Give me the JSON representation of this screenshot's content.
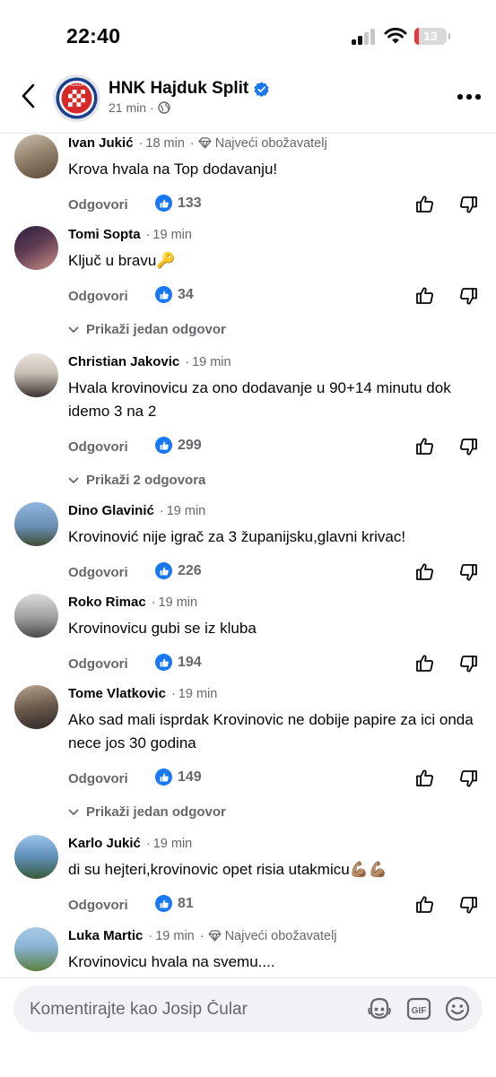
{
  "status_bar": {
    "time": "22:40",
    "battery": "13",
    "battery_color": "#e5383b"
  },
  "header": {
    "page_name": "HNK Hajduk Split",
    "time": "21 min",
    "separator": "·",
    "icons": {
      "back": "chevron-left-icon",
      "verified": "verified-badge-icon",
      "audience": "globe-icon",
      "more": "more-horizontal-icon"
    }
  },
  "actions_labels": {
    "reply": "Odgovori"
  },
  "accent_color": "#1877f2",
  "comments": [
    {
      "author": "Ivan Jukić",
      "time": "18 min",
      "badge": "Najveći obožavatelj",
      "text": "Krova hvala na Top dodavanju!",
      "likes": "133",
      "replies_label": ""
    },
    {
      "author": "Tomi Sopta",
      "time": "19 min",
      "badge": "",
      "text": "Ključ u bravu🔑",
      "likes": "34",
      "replies_label": "Prikaži jedan odgovor"
    },
    {
      "author": "Christian Jakovic",
      "time": "19 min",
      "badge": "",
      "text": "Hvala krovinovicu za ono dodavanje u 90+14 minutu dok idemo 3 na 2",
      "likes": "299",
      "replies_label": "Prikaži 2 odgovora"
    },
    {
      "author": "Dino Glavinić",
      "time": "19 min",
      "badge": "",
      "text": "Krovinović nije igrač za 3 županijsku,glavni krivac!",
      "likes": "226",
      "replies_label": ""
    },
    {
      "author": "Roko Rimac",
      "time": "19 min",
      "badge": "",
      "text": "Krovinovicu gubi se iz kluba",
      "likes": "194",
      "replies_label": ""
    },
    {
      "author": "Tome Vlatkovic",
      "time": "19 min",
      "badge": "",
      "text": "Ako sad mali isprdak Krovinovic ne dobije papire za ici onda nece jos 30 godina",
      "likes": "149",
      "replies_label": "Prikaži jedan odgovor"
    },
    {
      "author": "Karlo Jukić",
      "time": "19 min",
      "badge": "",
      "text": "di su hejteri,krovinovic opet risia utakmicu💪🏽💪🏽",
      "likes": "81",
      "replies_label": ""
    },
    {
      "author": "Luka Martic",
      "time": "19 min",
      "badge": "Najveći obožavatelj",
      "text": "Krovinovicu hvala na svemu....",
      "likes": "",
      "replies_label": ""
    }
  ],
  "composer": {
    "placeholder": "Komentirajte kao Josip Čular",
    "icons": [
      "avatar-sticker-icon",
      "gif-icon",
      "emoji-icon"
    ]
  }
}
